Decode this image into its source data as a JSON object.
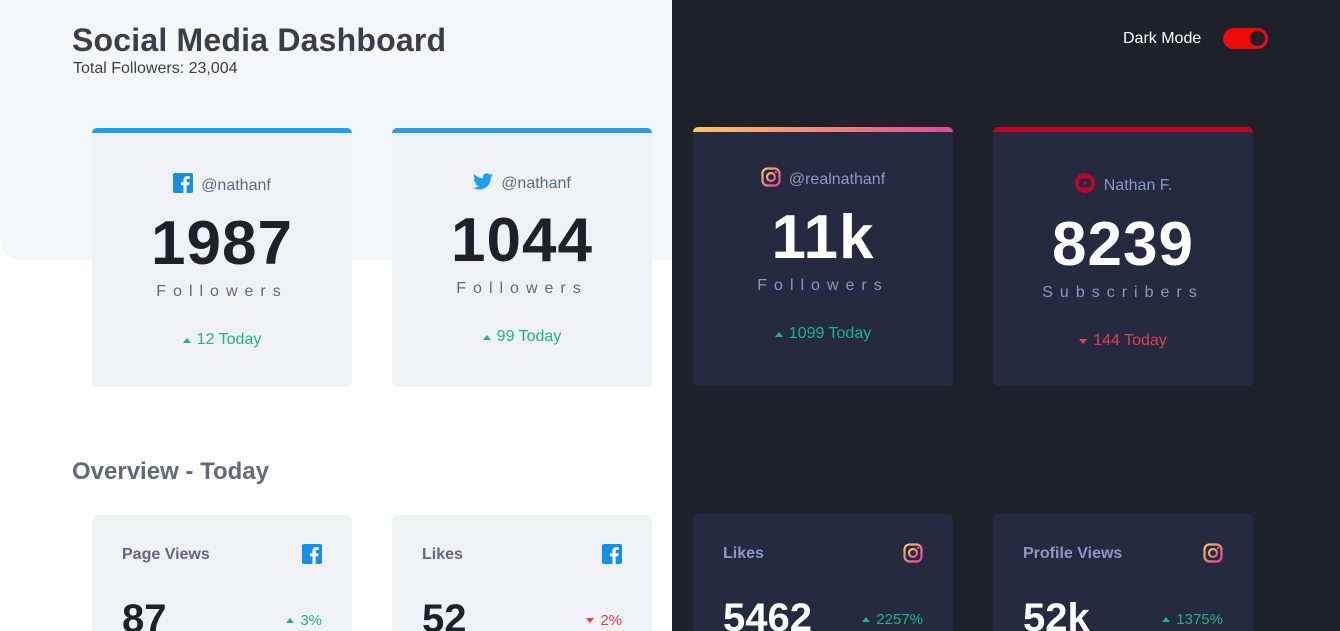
{
  "header": {
    "title": "Social Media Dashboard",
    "subtitle": "Total Followers: 23,004",
    "dark_mode_label": "Dark Mode"
  },
  "colors": {
    "facebook": "#178fe6",
    "twitter": "#1ca0f2",
    "instagram_gradient": [
      "#fdc468",
      "#df4996"
    ],
    "youtube": "#c4032a",
    "up": "#1db489",
    "down": "#dc414c",
    "toggle": "#f00a0a"
  },
  "cards": [
    {
      "network": "facebook",
      "icon": "facebook-icon",
      "handle": "@nathanf",
      "count": "1987",
      "unit": "Followers",
      "change": "12 Today",
      "direction": "up"
    },
    {
      "network": "twitter",
      "icon": "twitter-icon",
      "handle": "@nathanf",
      "count": "1044",
      "unit": "Followers",
      "change": "99 Today",
      "direction": "up"
    },
    {
      "network": "instagram",
      "icon": "instagram-icon",
      "handle": "@realnathanf",
      "count": "11k",
      "unit": "Followers",
      "change": "1099 Today",
      "direction": "up"
    },
    {
      "network": "youtube",
      "icon": "youtube-icon",
      "handle": "Nathan F.",
      "count": "8239",
      "unit": "Subscribers",
      "change": "144 Today",
      "direction": "down"
    }
  ],
  "overview": {
    "title": "Overview - Today",
    "items": [
      {
        "label": "Page Views",
        "icon": "facebook-icon",
        "value": "87",
        "change": "3%",
        "direction": "up"
      },
      {
        "label": "Likes",
        "icon": "facebook-icon",
        "value": "52",
        "change": "2%",
        "direction": "down"
      },
      {
        "label": "Likes",
        "icon": "instagram-icon",
        "value": "5462",
        "change": "2257%",
        "direction": "up"
      },
      {
        "label": "Profile Views",
        "icon": "instagram-icon",
        "value": "52k",
        "change": "1375%",
        "direction": "up"
      }
    ]
  }
}
